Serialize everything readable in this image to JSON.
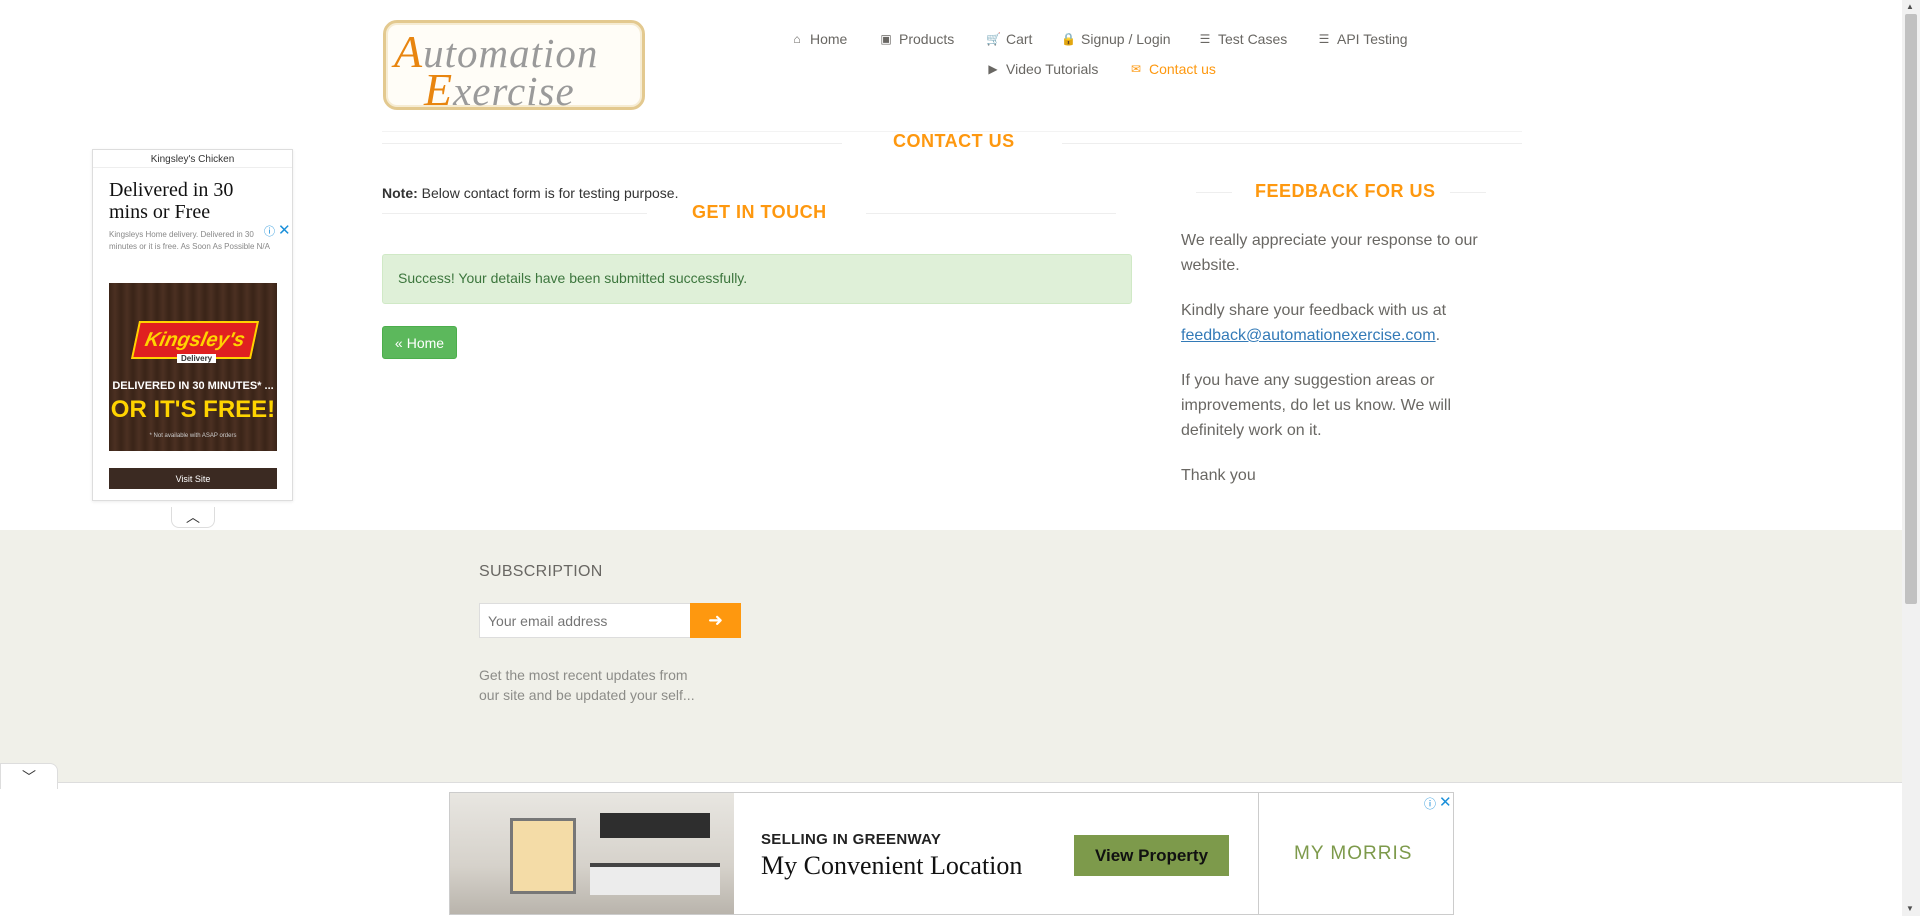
{
  "logo": {
    "line1_first": "A",
    "line1_rest": "utomation",
    "line2_first": "E",
    "line2_rest": "xercise"
  },
  "nav": {
    "items": [
      {
        "icon": "⌂",
        "label": "Home"
      },
      {
        "icon": "▣",
        "label": "Products"
      },
      {
        "icon": "🛒",
        "label": "Cart"
      },
      {
        "icon": "🔒",
        "label": "Signup / Login"
      },
      {
        "icon": "☰",
        "label": "Test Cases"
      },
      {
        "icon": "☰",
        "label": "API Testing"
      },
      {
        "icon": "▶",
        "label": "Video Tutorials"
      },
      {
        "icon": "✉",
        "label": "Contact us"
      }
    ],
    "active": "Contact us"
  },
  "page": {
    "title": "CONTACT US",
    "note_label": "Note:",
    "note_text": " Below contact form is for testing purpose.",
    "get_in_touch": "GET IN TOUCH",
    "success_message": "Success! Your details have been submitted successfully.",
    "home_button": "Home",
    "home_icon": "«"
  },
  "feedback": {
    "title": "FEEDBACK FOR US",
    "p1": "We really appreciate your response to our website.",
    "p2_prefix": "Kindly share your feedback with us at ",
    "p2_email": "feedback@automationexercise.com",
    "p2_suffix": ".",
    "p3": "If you have any suggestion areas or improvements, do let us know. We will definitely work on it.",
    "p4": "Thank you"
  },
  "ad_left": {
    "source": "Kingsley's Chicken",
    "headline": "Delivered in 30 mins or Free",
    "description": "Kingsleys Home delivery. Delivered in 30 minutes or it is free. As Soon As Possible N/A",
    "brand": "Kingsley's",
    "brand_sub": "Delivery",
    "promo_line1": "DELIVERED IN 30 MINUTES* ...",
    "promo_line2": "OR IT'S FREE!",
    "promo_footnote": "* Not available with ASAP orders",
    "cta": "Visit Site"
  },
  "footer": {
    "subscription_title": "SUBSCRIPTION",
    "email_placeholder": "Your email address",
    "subscription_desc": "Get the most recent updates from our site and be updated your self..."
  },
  "ad_bottom": {
    "small_text": "SELLING IN GREENWAY",
    "large_text": "My Convenient Location",
    "cta": "View Property",
    "brand": "MY MORRIS"
  },
  "colors": {
    "accent": "#fe980f",
    "success_bg": "#dff0d8",
    "success_text": "#3c763d",
    "button_green": "#5cb85c",
    "footer_bg": "#f0f0e9",
    "link": "#337ab7"
  }
}
